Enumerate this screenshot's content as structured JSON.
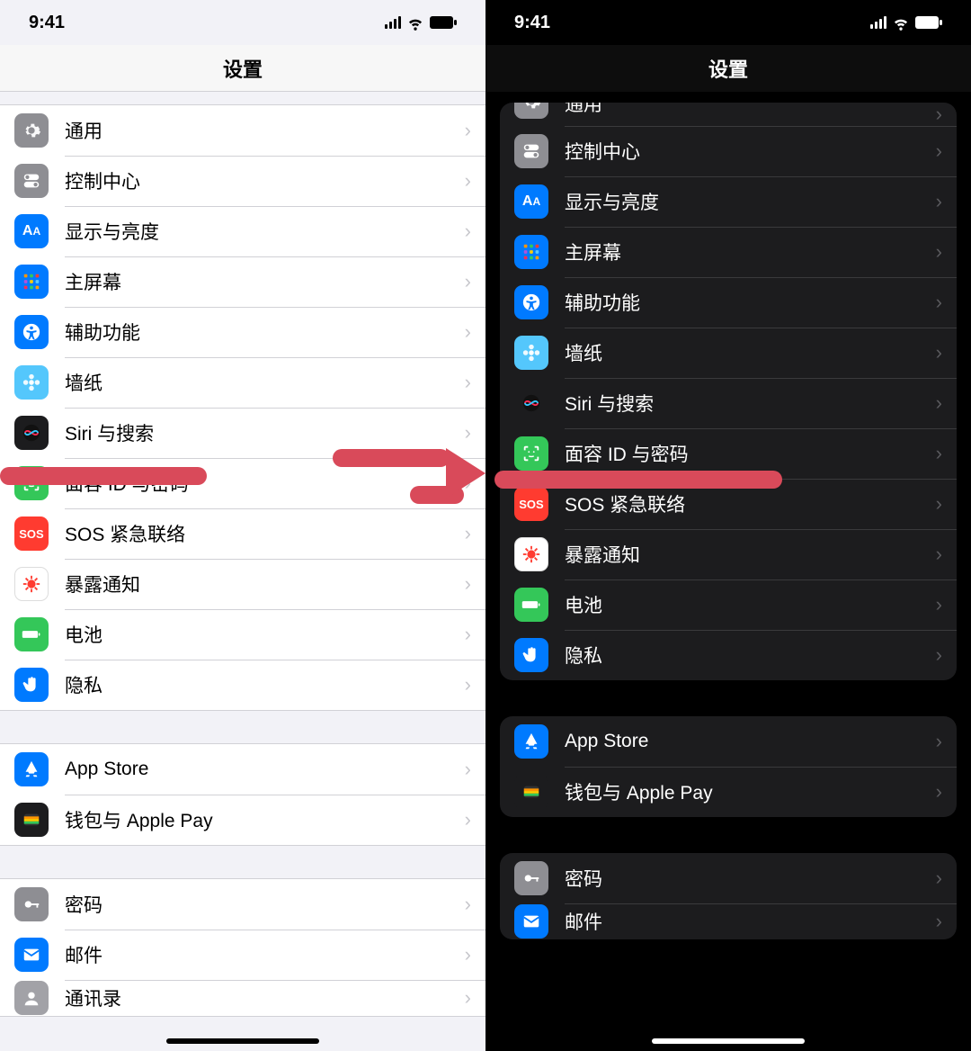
{
  "status": {
    "time": "9:41"
  },
  "title": "设置",
  "groups_light": [
    [
      {
        "key": "general",
        "label": "通用",
        "icon": "gear",
        "bg": "bg-gray"
      },
      {
        "key": "control-center",
        "label": "控制中心",
        "icon": "toggles",
        "bg": "bg-gray"
      },
      {
        "key": "display",
        "label": "显示与亮度",
        "icon": "AA",
        "bg": "bg-blue"
      },
      {
        "key": "home-screen",
        "label": "主屏幕",
        "icon": "grid",
        "bg": "bg-blue"
      },
      {
        "key": "accessibility",
        "label": "辅助功能",
        "icon": "access",
        "bg": "bg-blue"
      },
      {
        "key": "wallpaper",
        "label": "墙纸",
        "icon": "flower",
        "bg": "bg-lblue"
      },
      {
        "key": "siri",
        "label": "Siri 与搜索",
        "icon": "siri",
        "bg": "bg-black"
      },
      {
        "key": "faceid",
        "label": "面容 ID 与密码",
        "icon": "faceid",
        "bg": "bg-green"
      },
      {
        "key": "sos",
        "label": "SOS 紧急联络",
        "icon": "SOS",
        "bg": "bg-red"
      },
      {
        "key": "exposure",
        "label": "暴露通知",
        "icon": "virus",
        "bg": "bg-white"
      },
      {
        "key": "battery",
        "label": "电池",
        "icon": "battery",
        "bg": "bg-green"
      },
      {
        "key": "privacy",
        "label": "隐私",
        "icon": "hand",
        "bg": "bg-blue"
      }
    ],
    [
      {
        "key": "appstore",
        "label": "App Store",
        "icon": "appstore",
        "bg": "bg-blue"
      },
      {
        "key": "wallet",
        "label": "钱包与 Apple Pay",
        "icon": "wallet",
        "bg": "bg-black"
      }
    ],
    [
      {
        "key": "passwords",
        "label": "密码",
        "icon": "key",
        "bg": "bg-gray"
      },
      {
        "key": "mail",
        "label": "邮件",
        "icon": "mail",
        "bg": "bg-blue"
      },
      {
        "key": "contacts",
        "label": "通讯录",
        "icon": "contact",
        "bg": "bg-gray2"
      }
    ]
  ],
  "groups_dark": [
    [
      {
        "key": "general",
        "label": "通用",
        "icon": "gear",
        "bg": "bg-gray",
        "partial": true
      },
      {
        "key": "control-center",
        "label": "控制中心",
        "icon": "toggles",
        "bg": "bg-gray"
      },
      {
        "key": "display",
        "label": "显示与亮度",
        "icon": "AA",
        "bg": "bg-blue"
      },
      {
        "key": "home-screen",
        "label": "主屏幕",
        "icon": "grid",
        "bg": "bg-blue"
      },
      {
        "key": "accessibility",
        "label": "辅助功能",
        "icon": "access",
        "bg": "bg-blue"
      },
      {
        "key": "wallpaper",
        "label": "墙纸",
        "icon": "flower",
        "bg": "bg-lblue"
      },
      {
        "key": "siri",
        "label": "Siri 与搜索",
        "icon": "siri",
        "bg": "bg-black"
      },
      {
        "key": "faceid",
        "label": "面容 ID 与密码",
        "icon": "faceid",
        "bg": "bg-green"
      },
      {
        "key": "sos",
        "label": "SOS 紧急联络",
        "icon": "SOS",
        "bg": "bg-red"
      },
      {
        "key": "exposure",
        "label": "暴露通知",
        "icon": "virus",
        "bg": "bg-white"
      },
      {
        "key": "battery",
        "label": "电池",
        "icon": "battery",
        "bg": "bg-green"
      },
      {
        "key": "privacy",
        "label": "隐私",
        "icon": "hand",
        "bg": "bg-blue"
      }
    ],
    [
      {
        "key": "appstore",
        "label": "App Store",
        "icon": "appstore",
        "bg": "bg-blue"
      },
      {
        "key": "wallet",
        "label": "钱包与 Apple Pay",
        "icon": "wallet",
        "bg": "bg-black"
      }
    ],
    [
      {
        "key": "passwords",
        "label": "密码",
        "icon": "key",
        "bg": "bg-gray"
      },
      {
        "key": "mail",
        "label": "邮件",
        "icon": "mail",
        "bg": "bg-blue"
      }
    ]
  ]
}
